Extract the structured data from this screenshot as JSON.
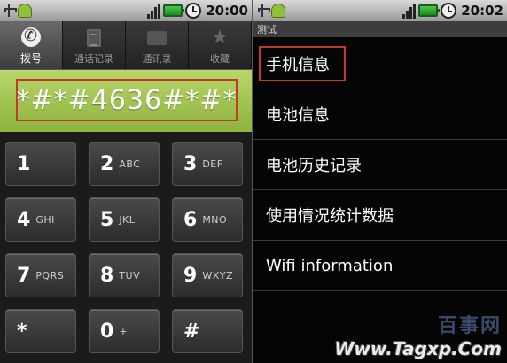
{
  "left_phone": {
    "status_time": "20:00",
    "tabs": [
      {
        "label": "拨号",
        "icon": "phone-icon",
        "active": true
      },
      {
        "label": "通话记录",
        "icon": "call-log-icon",
        "active": false
      },
      {
        "label": "通讯录",
        "icon": "contacts-icon",
        "active": false
      },
      {
        "label": "收藏",
        "icon": "star-icon",
        "active": false
      }
    ],
    "dialed_number": "*#*#4636#*#*",
    "keys": [
      {
        "num": "1",
        "letters": ""
      },
      {
        "num": "2",
        "letters": "ABC"
      },
      {
        "num": "3",
        "letters": "DEF"
      },
      {
        "num": "4",
        "letters": "GHI"
      },
      {
        "num": "5",
        "letters": "JKL"
      },
      {
        "num": "6",
        "letters": "MNO"
      },
      {
        "num": "7",
        "letters": "PQRS"
      },
      {
        "num": "8",
        "letters": "TUV"
      },
      {
        "num": "9",
        "letters": "WXYZ"
      },
      {
        "num": "*",
        "letters": ""
      },
      {
        "num": "0",
        "letters": "+"
      },
      {
        "num": "#",
        "letters": ""
      }
    ]
  },
  "right_phone": {
    "status_time": "20:02",
    "title": "测试",
    "menu_items": [
      "手机信息",
      "电池信息",
      "电池历史记录",
      "使用情况统计数据",
      "Wifi information"
    ]
  },
  "watermark": {
    "cn": "百事网",
    "url": "Www.Tagxp.Com"
  },
  "colors": {
    "dial_bar": "#9cc24a",
    "highlight": "#c23a2a"
  }
}
